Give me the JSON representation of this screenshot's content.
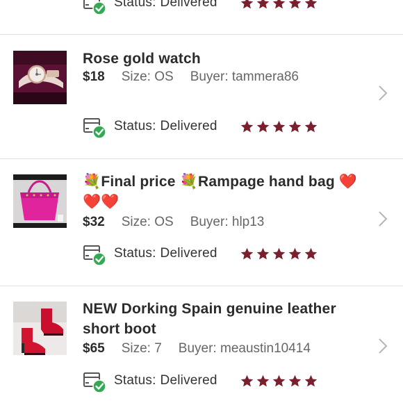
{
  "status_label": "Status:",
  "delivered_label": "Delivered",
  "colors": {
    "star": "#7a1f2e",
    "check": "#34a853",
    "divider": "#e2e2e2",
    "muted_text": "#666666"
  },
  "top_row": {
    "status_label": "Status:",
    "status_value": "Delivered"
  },
  "orders": [
    {
      "title": "Rose gold watch",
      "price": "$18",
      "size": "Size: OS",
      "buyer": "Buyer: tammera86",
      "status_label": "Status:",
      "status_value": "Delivered",
      "rating": 5,
      "thumbnail_icon": "watch-photo"
    },
    {
      "title": "💐Final price 💐Rampage hand bag ❤️❤️❤️",
      "price": "$32",
      "size": "Size: OS",
      "buyer": "Buyer: hlp13",
      "status_label": "Status:",
      "status_value": "Delivered",
      "rating": 5,
      "thumbnail_icon": "handbag-photo"
    },
    {
      "title": "NEW Dorking Spain genuine leather short boot",
      "price": "$65",
      "size": "Size: 7",
      "buyer": "Buyer: meaustin10414",
      "status_label": "Status:",
      "status_value": "Delivered",
      "rating": 5,
      "thumbnail_icon": "boots-photo"
    }
  ]
}
